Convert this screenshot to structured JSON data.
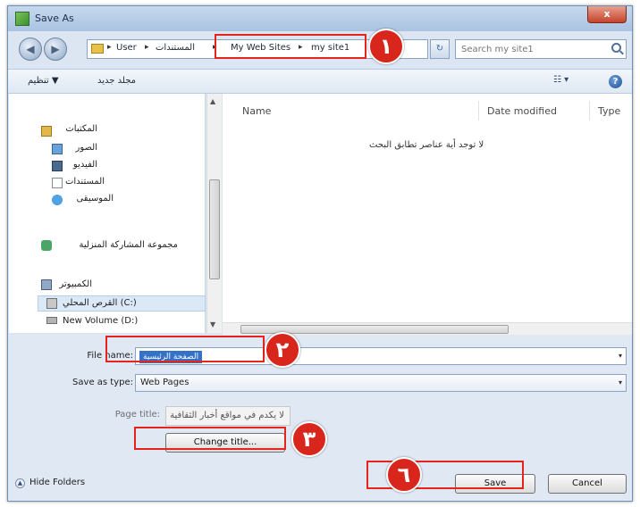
{
  "window": {
    "title": "Save As",
    "close_glyph": "x"
  },
  "nav": {
    "back_glyph": "◀",
    "forward_glyph": "▶",
    "breadcrumb": [
      "User",
      "المستندات",
      "My Web Sites",
      "my site1"
    ],
    "separator": "▸",
    "refresh_glyph": "↻",
    "search_placeholder": "Search my site1"
  },
  "toolbar": {
    "organize_label": "تنظيم ▼",
    "new_folder_label": "مجلد جديد",
    "views_glyph": "☷ ▾",
    "help_glyph": "?"
  },
  "sidebar": {
    "libraries_label": "المكتبات",
    "items": [
      "الصور",
      "الفيديو",
      "المستندات",
      "الموسيقى"
    ],
    "homegroup_label": "مجموعة المشاركة المنزلية",
    "computer_label": "الكمبيوتر",
    "drives": [
      "القرص المحلي (C:)",
      "New Volume (D:)"
    ]
  },
  "columns": [
    "Name",
    "Date modified",
    "Type"
  ],
  "empty_message": "لا توجد أية عناصر تطابق البحث",
  "form": {
    "filename_label": "File name:",
    "filename_value": "الصفحة الرئيسية",
    "type_label": "Save as type:",
    "type_value": "Web Pages",
    "pagetitle_label": "Page title:",
    "pagetitle_value": "لا يكدم في مواقع أخبار الثقافية",
    "change_title_label": "Change title...",
    "save_label": "Save",
    "cancel_label": "Cancel",
    "hide_folders_label": "Hide Folders",
    "dropdown_glyph": "▾"
  },
  "annotations": {
    "badge_1": "١",
    "badge_2": "٢",
    "badge_3": "٣",
    "badge_6": "٦",
    "accent_color": "#d9261c"
  }
}
